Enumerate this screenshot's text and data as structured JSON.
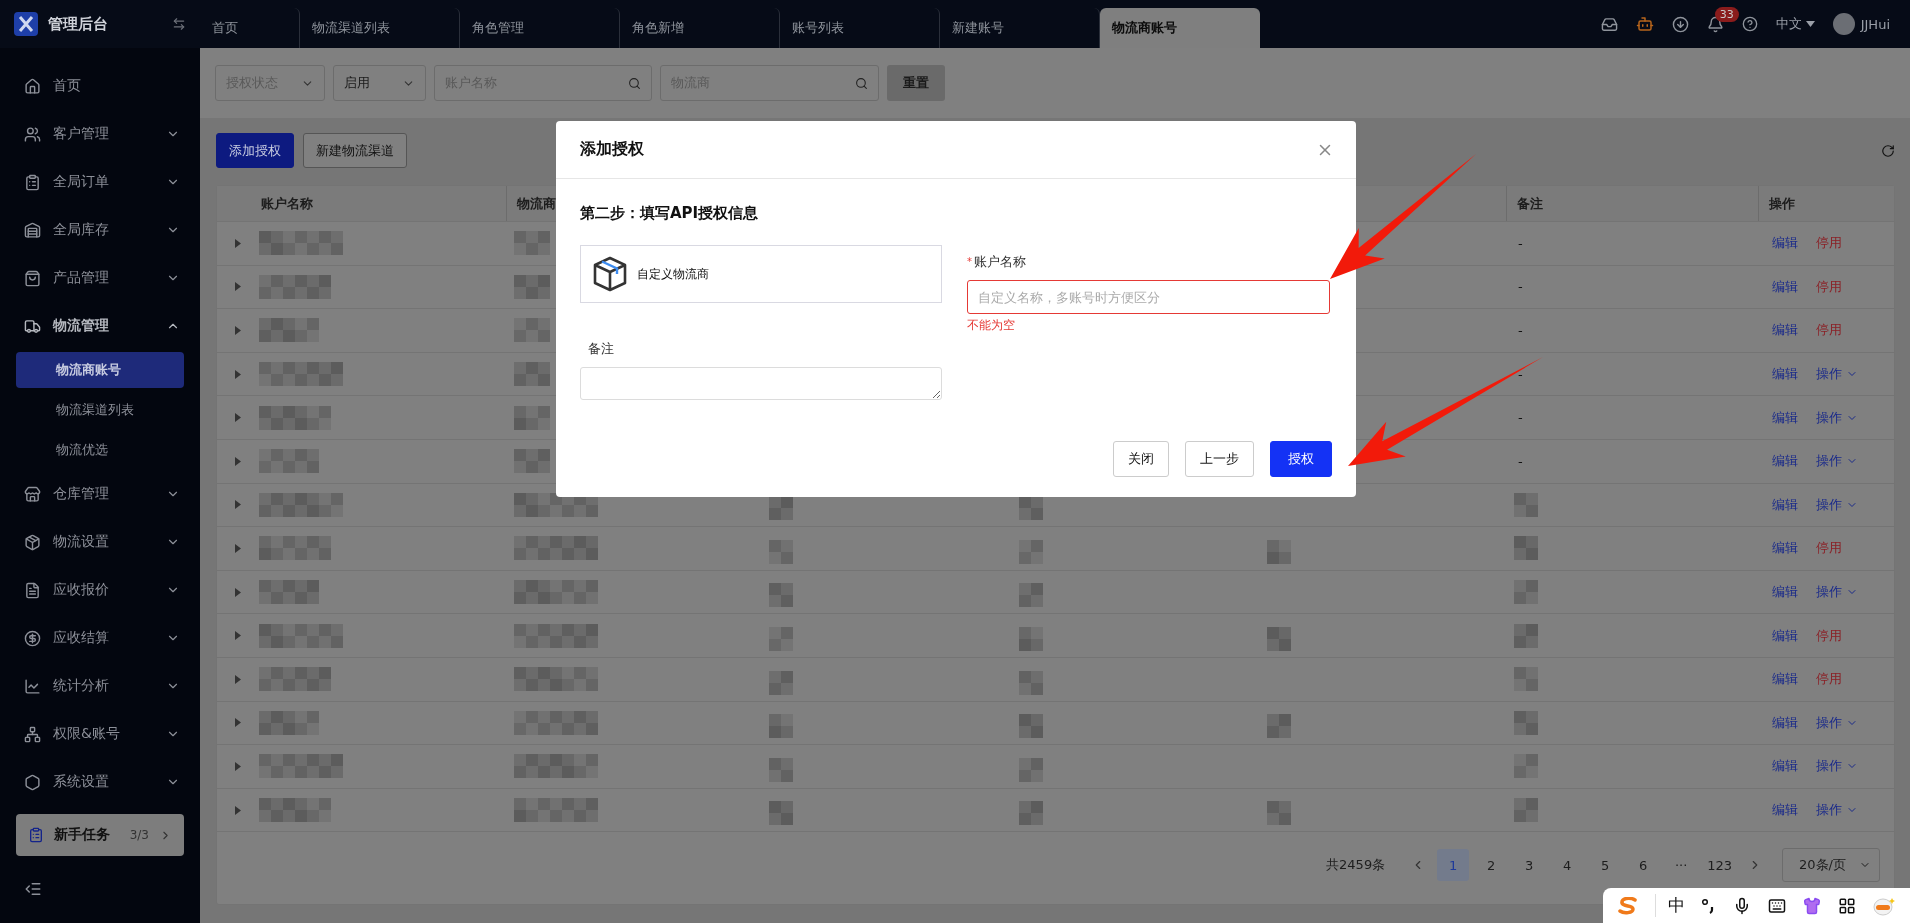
{
  "topbar": {
    "brand": "管理后台",
    "tabs": [
      {
        "label": "首页",
        "selected": false
      },
      {
        "label": "物流渠道列表",
        "selected": false
      },
      {
        "label": "角色管理",
        "selected": false
      },
      {
        "label": "角色新增",
        "selected": false
      },
      {
        "label": "账号列表",
        "selected": false
      },
      {
        "label": "新建账号",
        "selected": false
      },
      {
        "label": "物流商账号",
        "selected": true
      }
    ],
    "notification_badge": "33",
    "language": "中文",
    "user": "JJHui"
  },
  "sidebar": {
    "items": [
      {
        "label": "首页"
      },
      {
        "label": "客户管理",
        "expanded": false
      },
      {
        "label": "全局订单",
        "expanded": false
      },
      {
        "label": "全局库存",
        "expanded": false
      },
      {
        "label": "产品管理",
        "expanded": false
      },
      {
        "label": "物流管理",
        "expanded": true,
        "children": [
          {
            "label": "物流商账号",
            "selected": true
          },
          {
            "label": "物流渠道列表",
            "selected": false
          },
          {
            "label": "物流优选",
            "selected": false
          }
        ]
      },
      {
        "label": "仓库管理",
        "expanded": false
      },
      {
        "label": "物流设置",
        "expanded": false
      },
      {
        "label": "应收报价",
        "expanded": false
      },
      {
        "label": "应收结算",
        "expanded": false
      },
      {
        "label": "统计分析",
        "expanded": false
      },
      {
        "label": "权限&账号",
        "expanded": false
      },
      {
        "label": "系统设置",
        "expanded": false
      }
    ],
    "task_card": {
      "label": "新手任务",
      "progress": "3/3"
    }
  },
  "filters": [
    {
      "kind": "select",
      "placeholder": "授权状态"
    },
    {
      "kind": "select",
      "value": "启用"
    },
    {
      "kind": "search",
      "placeholder": "账户名称"
    },
    {
      "kind": "search",
      "placeholder": "物流商"
    }
  ],
  "reset_button": "重置",
  "toolbar": [
    {
      "label": "添加授权",
      "kind": "primary"
    },
    {
      "label": "新建物流渠道",
      "kind": "default"
    }
  ],
  "table": {
    "columns": {
      "account": "账户名称",
      "provider": "物流商",
      "remark": "备注",
      "actions": "操作"
    },
    "rows": [
      {
        "remark": "-",
        "edit": "编辑",
        "action": "停用",
        "dropdown": false
      },
      {
        "remark": "-",
        "edit": "编辑",
        "action": "停用",
        "dropdown": false
      },
      {
        "remark": "-",
        "edit": "编辑",
        "action": "停用",
        "dropdown": false
      },
      {
        "remark": "-",
        "edit": "编辑",
        "action": "操作",
        "dropdown": true
      },
      {
        "remark": "-",
        "edit": "编辑",
        "action": "操作",
        "dropdown": true
      },
      {
        "remark": "-",
        "edit": "编辑",
        "action": "操作",
        "dropdown": true
      },
      {
        "edit": "编辑",
        "action": "操作",
        "dropdown": true
      },
      {
        "edit": "编辑",
        "action": "停用",
        "dropdown": false
      },
      {
        "edit": "编辑",
        "action": "操作",
        "dropdown": true
      },
      {
        "edit": "编辑",
        "action": "停用",
        "dropdown": false
      },
      {
        "edit": "编辑",
        "action": "停用",
        "dropdown": false
      },
      {
        "edit": "编辑",
        "action": "操作",
        "dropdown": true
      },
      {
        "edit": "编辑",
        "action": "操作",
        "dropdown": true
      },
      {
        "edit": "编辑",
        "action": "操作",
        "dropdown": true
      }
    ]
  },
  "pagination": {
    "total": "共2459条",
    "pages": [
      {
        "label": "1",
        "selected": true
      },
      {
        "label": "2",
        "selected": false
      },
      {
        "label": "3",
        "selected": false
      },
      {
        "label": "4",
        "selected": false
      },
      {
        "label": "5",
        "selected": false
      },
      {
        "label": "6",
        "selected": false
      },
      {
        "label": "···",
        "selected": false
      },
      {
        "label": "123",
        "selected": false
      }
    ],
    "page_size": "20条/页"
  },
  "modal": {
    "title": "添加授权",
    "step_title": "第二步：填写API授权信息",
    "provider": "自定义物流商",
    "account_field": {
      "label": "账户名称",
      "required_mark": "*",
      "placeholder": "自定义名称，多账号时方便区分",
      "error": "不能为空"
    },
    "remark_field": {
      "label": "备注"
    },
    "buttons": [
      {
        "label": "关闭",
        "kind": "default"
      },
      {
        "label": "上一步",
        "kind": "default"
      },
      {
        "label": "授权",
        "kind": "primary"
      }
    ]
  },
  "ime_toolbar": {
    "mode": "中"
  }
}
